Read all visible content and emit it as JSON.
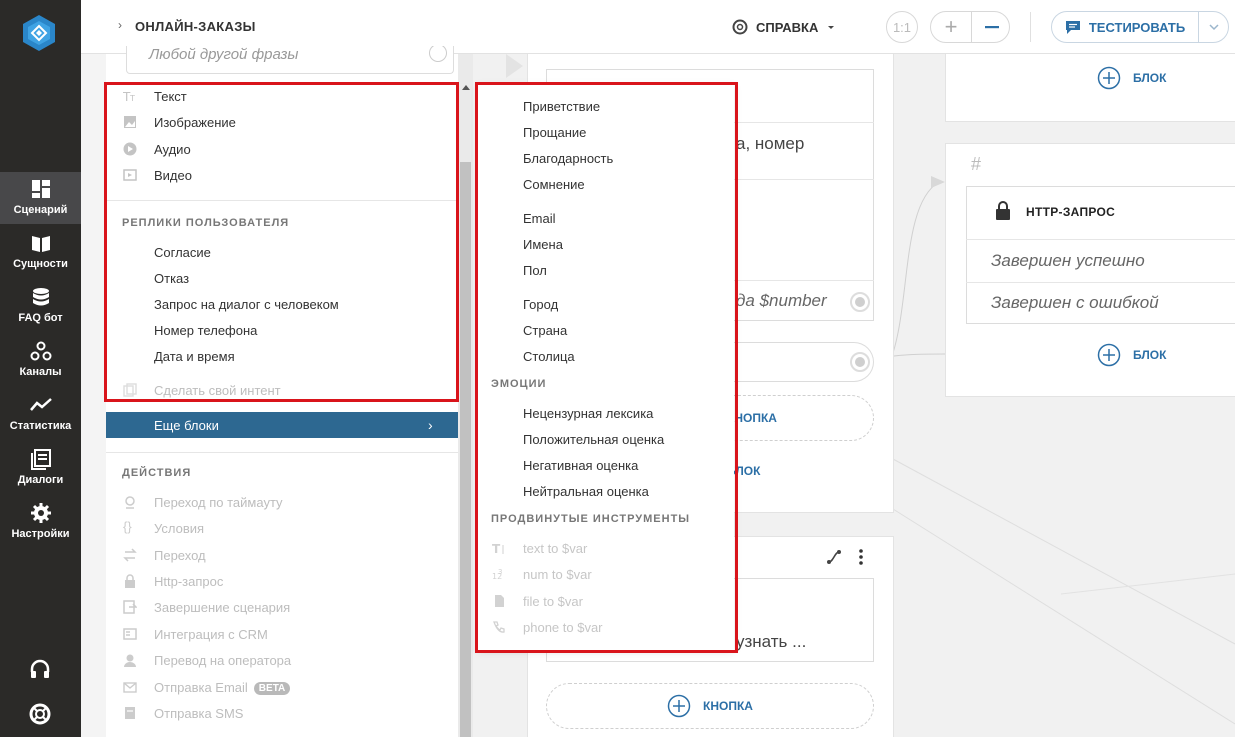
{
  "rail": {
    "items": [
      {
        "label": "Сценарий",
        "icon": "dashboard-icon",
        "active": true
      },
      {
        "label": "Сущности",
        "icon": "book-icon"
      },
      {
        "label": "FAQ бот",
        "icon": "database-icon"
      },
      {
        "label": "Каналы",
        "icon": "channels-icon"
      },
      {
        "label": "Статистика",
        "icon": "chart-line-icon"
      },
      {
        "label": "Диалоги",
        "icon": "dialogs-icon"
      },
      {
        "label": "Настройки",
        "icon": "gear-icon"
      }
    ],
    "bottom": [
      "headset-icon",
      "lifebuoy-icon"
    ]
  },
  "topbar": {
    "breadcrumb": "ОНЛАЙН-ЗАКАЗЫ",
    "help_label": "СПРАВКА",
    "zoom_reset_label": "1:1",
    "test_label": "ТЕСТИРОВАТЬ"
  },
  "palette": {
    "search_placeholder": "Любой другой фразы",
    "items_top": [
      {
        "label": "Текст",
        "icon": "text-icon"
      },
      {
        "label": "Изображение",
        "icon": "image-icon"
      },
      {
        "label": "Аудио",
        "icon": "play-icon"
      },
      {
        "label": "Видео",
        "icon": "video-icon"
      }
    ],
    "user_replies_header": "РЕПЛИКИ ПОЛЬЗОВАТЕЛЯ",
    "user_replies": [
      "Согласие",
      "Отказ",
      "Запрос на диалог с человеком",
      "Номер телефона",
      "Дата и время"
    ],
    "make_intent": "Сделать свой интент",
    "more_blocks": "Еще блоки",
    "actions_header": "ДЕЙСТВИЯ",
    "actions": [
      {
        "label": "Переход по таймауту",
        "icon": "timer-icon"
      },
      {
        "label": "Условия",
        "icon": "braces-icon"
      },
      {
        "label": "Переход",
        "icon": "transfer-icon"
      },
      {
        "label": "Http-запрос",
        "icon": "lock-icon"
      },
      {
        "label": "Завершение сценария",
        "icon": "exit-icon"
      },
      {
        "label": "Интеграция с CRM",
        "icon": "crm-icon"
      },
      {
        "label": "Перевод на оператора",
        "icon": "operator-icon"
      },
      {
        "label": "Отправка Email",
        "icon": "mail-icon",
        "badge": "BETA"
      },
      {
        "label": "Отправка SMS",
        "icon": "sms-icon"
      }
    ]
  },
  "submenu": {
    "group1": [
      "Приветствие",
      "Прощание",
      "Благодарность",
      "Сомнение"
    ],
    "group2": [
      "Email",
      "Имена",
      "Пол"
    ],
    "group3": [
      "Город",
      "Страна",
      "Столица"
    ],
    "emotions_header": "ЭМОЦИИ",
    "emotions": [
      "Нецензурная лексика",
      "Положительная оценка",
      "Негативная оценка",
      "Нейтральная оценка"
    ],
    "advanced_header": "ПРОДВИНУТЫЕ ИНСТРУМЕНТЫ",
    "advanced": [
      {
        "label": "text to $var",
        "icon": "text-var-icon"
      },
      {
        "label": "num to $var",
        "icon": "num-var-icon"
      },
      {
        "label": "file to $var",
        "icon": "file-icon"
      },
      {
        "label": "phone to $var",
        "icon": "phone-icon"
      }
    ]
  },
  "canvas": {
    "card1_text1": "а, номер",
    "card1_var": "да $number",
    "button_label": "КНОПКА",
    "block_label": "БЛОК",
    "card2_text": "узнать ...",
    "http_card": {
      "hash": "#",
      "title": "HTTP-ЗАПРОС",
      "success": "Завершен успешно",
      "error": "Завершен с ошибкой"
    }
  }
}
